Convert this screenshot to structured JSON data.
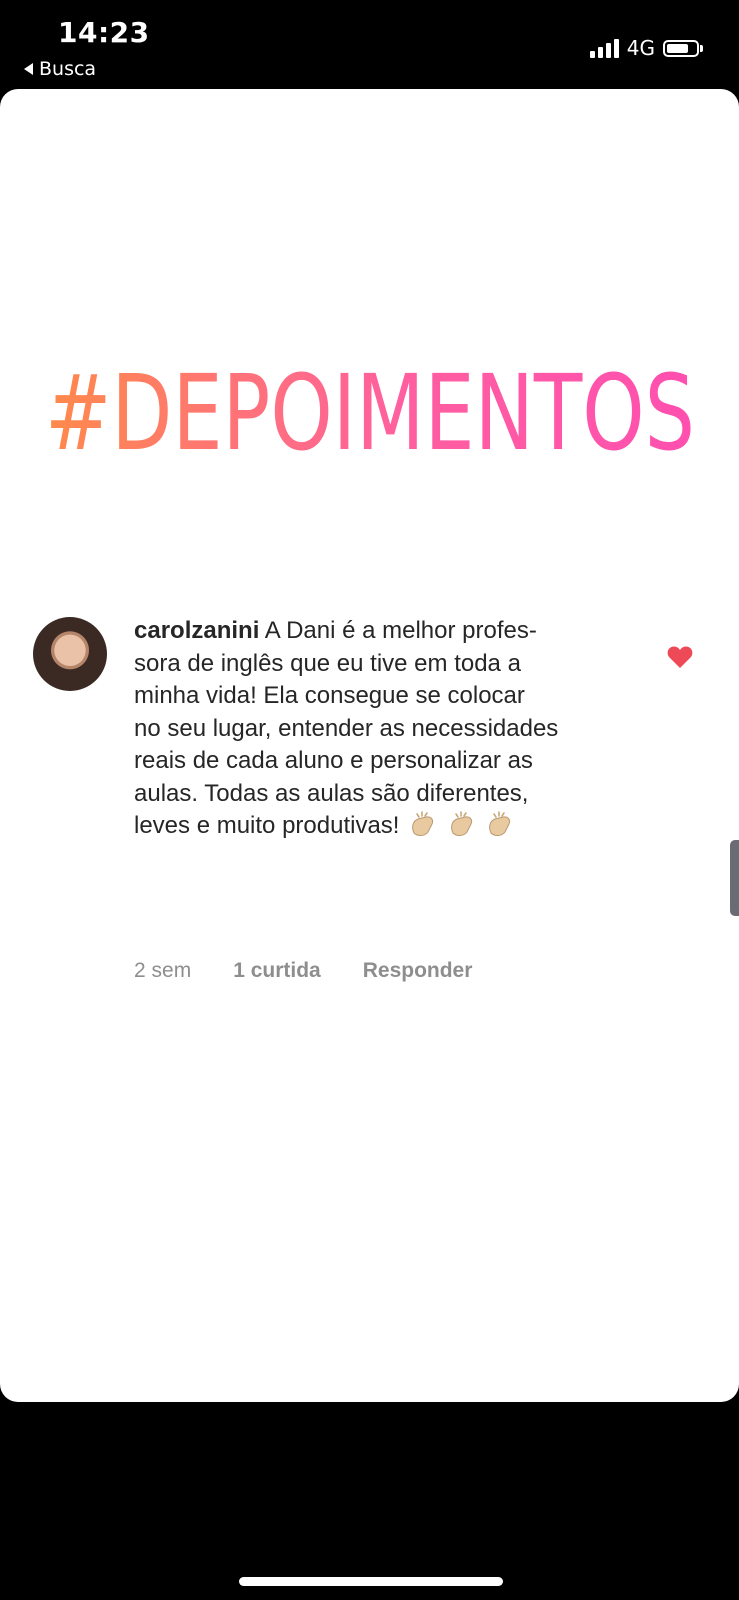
{
  "status_bar": {
    "time": "14:23",
    "back_label": "Busca",
    "network": "4G",
    "battery_level": 0.75
  },
  "story": {
    "headline": "#DEPOIMENTOS",
    "gradient_colors": [
      "#ff8a4a",
      "#ff5fa0",
      "#ff4fb0"
    ]
  },
  "comment": {
    "username": "carolzanini",
    "text_lines": [
      " A Dani é a melhor profes-",
      "sora de inglês que eu tive em toda a",
      "minha vida! Ela consegue se colocar",
      "no seu lugar, entender as necessidades",
      "reais de cada aluno e personalizar as",
      "aulas. Todas as aulas são diferentes,",
      "leves e muito produtivas!"
    ],
    "emoji": [
      "clapping-hands",
      "clapping-hands",
      "clapping-hands"
    ],
    "time_ago": "2 sem",
    "likes": "1 curtida",
    "reply": "Responder",
    "liked": true,
    "heart_color": "#ed4956"
  }
}
